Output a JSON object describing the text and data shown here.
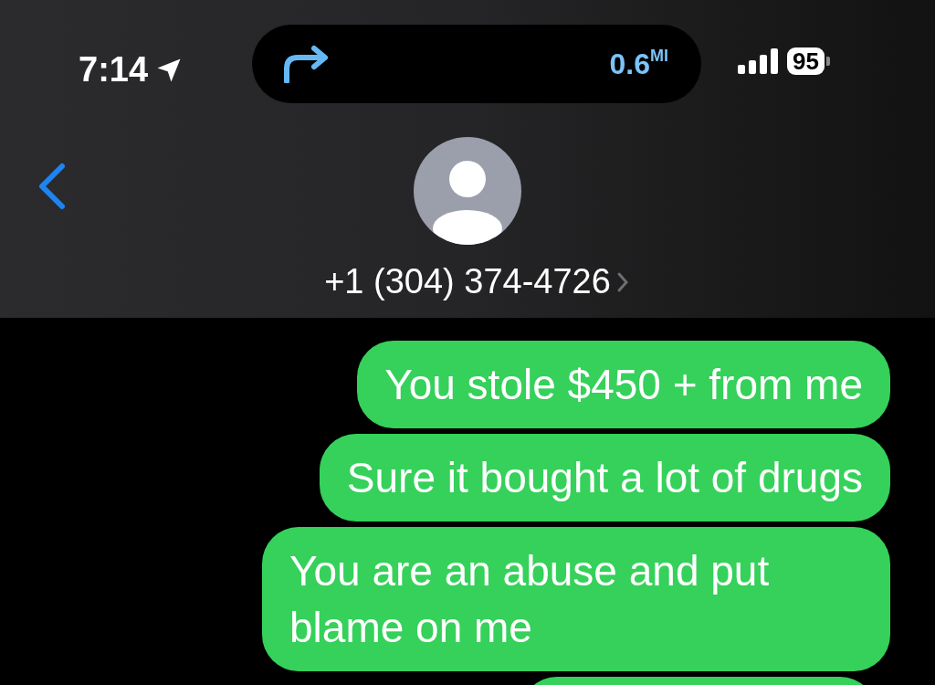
{
  "status_bar": {
    "time": "7:14",
    "distance": "0.6",
    "distance_unit": "MI",
    "battery": "95"
  },
  "contact": {
    "name": "+1 (304) 374-4726"
  },
  "messages": [
    {
      "text": "You stole $450 + from me"
    },
    {
      "text": "Sure it bought a lot of drugs"
    },
    {
      "text": "You are an abuse and put blame on me"
    }
  ]
}
